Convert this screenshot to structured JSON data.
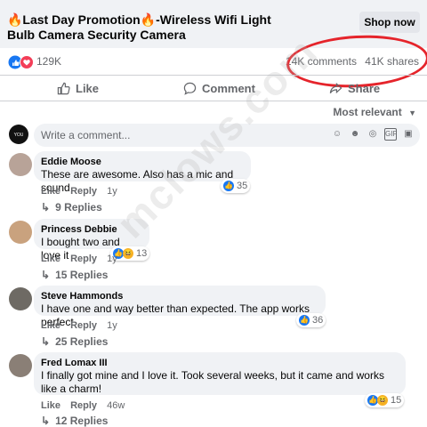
{
  "post": {
    "title": "🔥Last Day Promotion🔥-Wireless Wifi Light Bulb Camera Security Camera",
    "shop_button": "Shop now",
    "reaction_count": "129K",
    "comments_count": "14K comments",
    "shares_count": "41K shares"
  },
  "actions": {
    "like": "Like",
    "comment": "Comment",
    "share": "Share"
  },
  "sort": "Most relevant",
  "composer": {
    "placeholder": "Write a comment..."
  },
  "comments": [
    {
      "author": "Eddie Moose",
      "text": "These are awesome. Also has a mic and sound",
      "like": "Like",
      "reply": "Reply",
      "time": "1y",
      "reactions": "35",
      "replies": "9 Replies"
    },
    {
      "author": "Princess Debbie",
      "text": "I bought two and love it",
      "like": "Like",
      "reply": "Reply",
      "time": "1y",
      "reactions": "13",
      "replies": "15 Replies"
    },
    {
      "author": "Steve Hammonds",
      "text": "I have one and way better than expected. The app works perfect",
      "like": "Like",
      "reply": "Reply",
      "time": "1y",
      "reactions": "36",
      "replies": "25 Replies"
    },
    {
      "author": "Fred Lomax III",
      "text": "I finally got mine and I love it. Took several weeks, but it came and works like a charm!",
      "like": "Like",
      "reply": "Reply",
      "time": "46w",
      "reactions": "15",
      "replies": "12 Replies"
    }
  ],
  "watermark": "mclows.com",
  "colors": {
    "like_blue": "#1877f2",
    "love_red": "#f33e58",
    "annotation_red": "#e5242b",
    "bubble_gray": "#f0f2f5",
    "meta_gray": "#65676b"
  }
}
